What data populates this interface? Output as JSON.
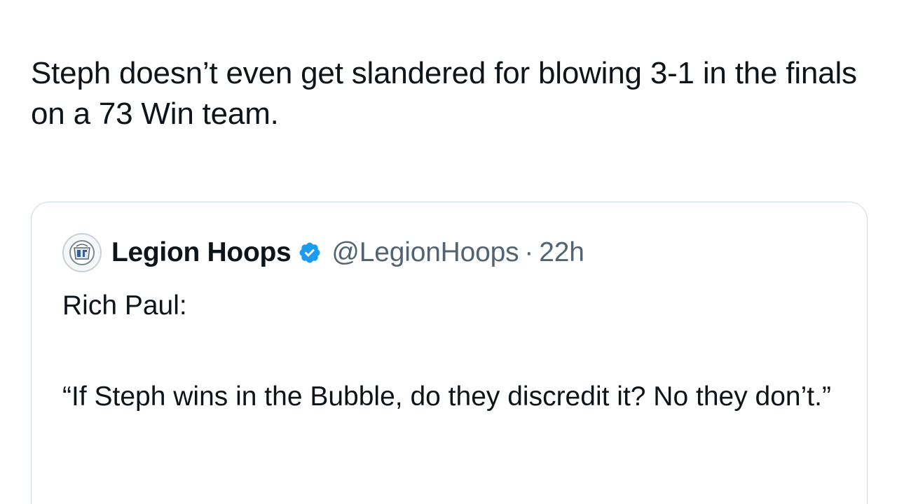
{
  "tweet": {
    "text": "Steph doesn’t even get slandered for blowing 3-1 in the finals on a 73 Win team."
  },
  "quoted_tweet": {
    "display_name": "Legion Hoops",
    "handle": "@LegionHoops",
    "separator": "·",
    "time": "22h",
    "verified": true,
    "avatar_icon": "legion-hoops-logo-icon",
    "line1": "Rich Paul:",
    "quote": "“If Steph wins in the Bubble, do they discredit it? No they don’t.”"
  },
  "colors": {
    "text": "#0f1419",
    "secondary_text": "#536471",
    "verified_blue": "#1d9bf0",
    "card_border": "#cfd9de"
  }
}
